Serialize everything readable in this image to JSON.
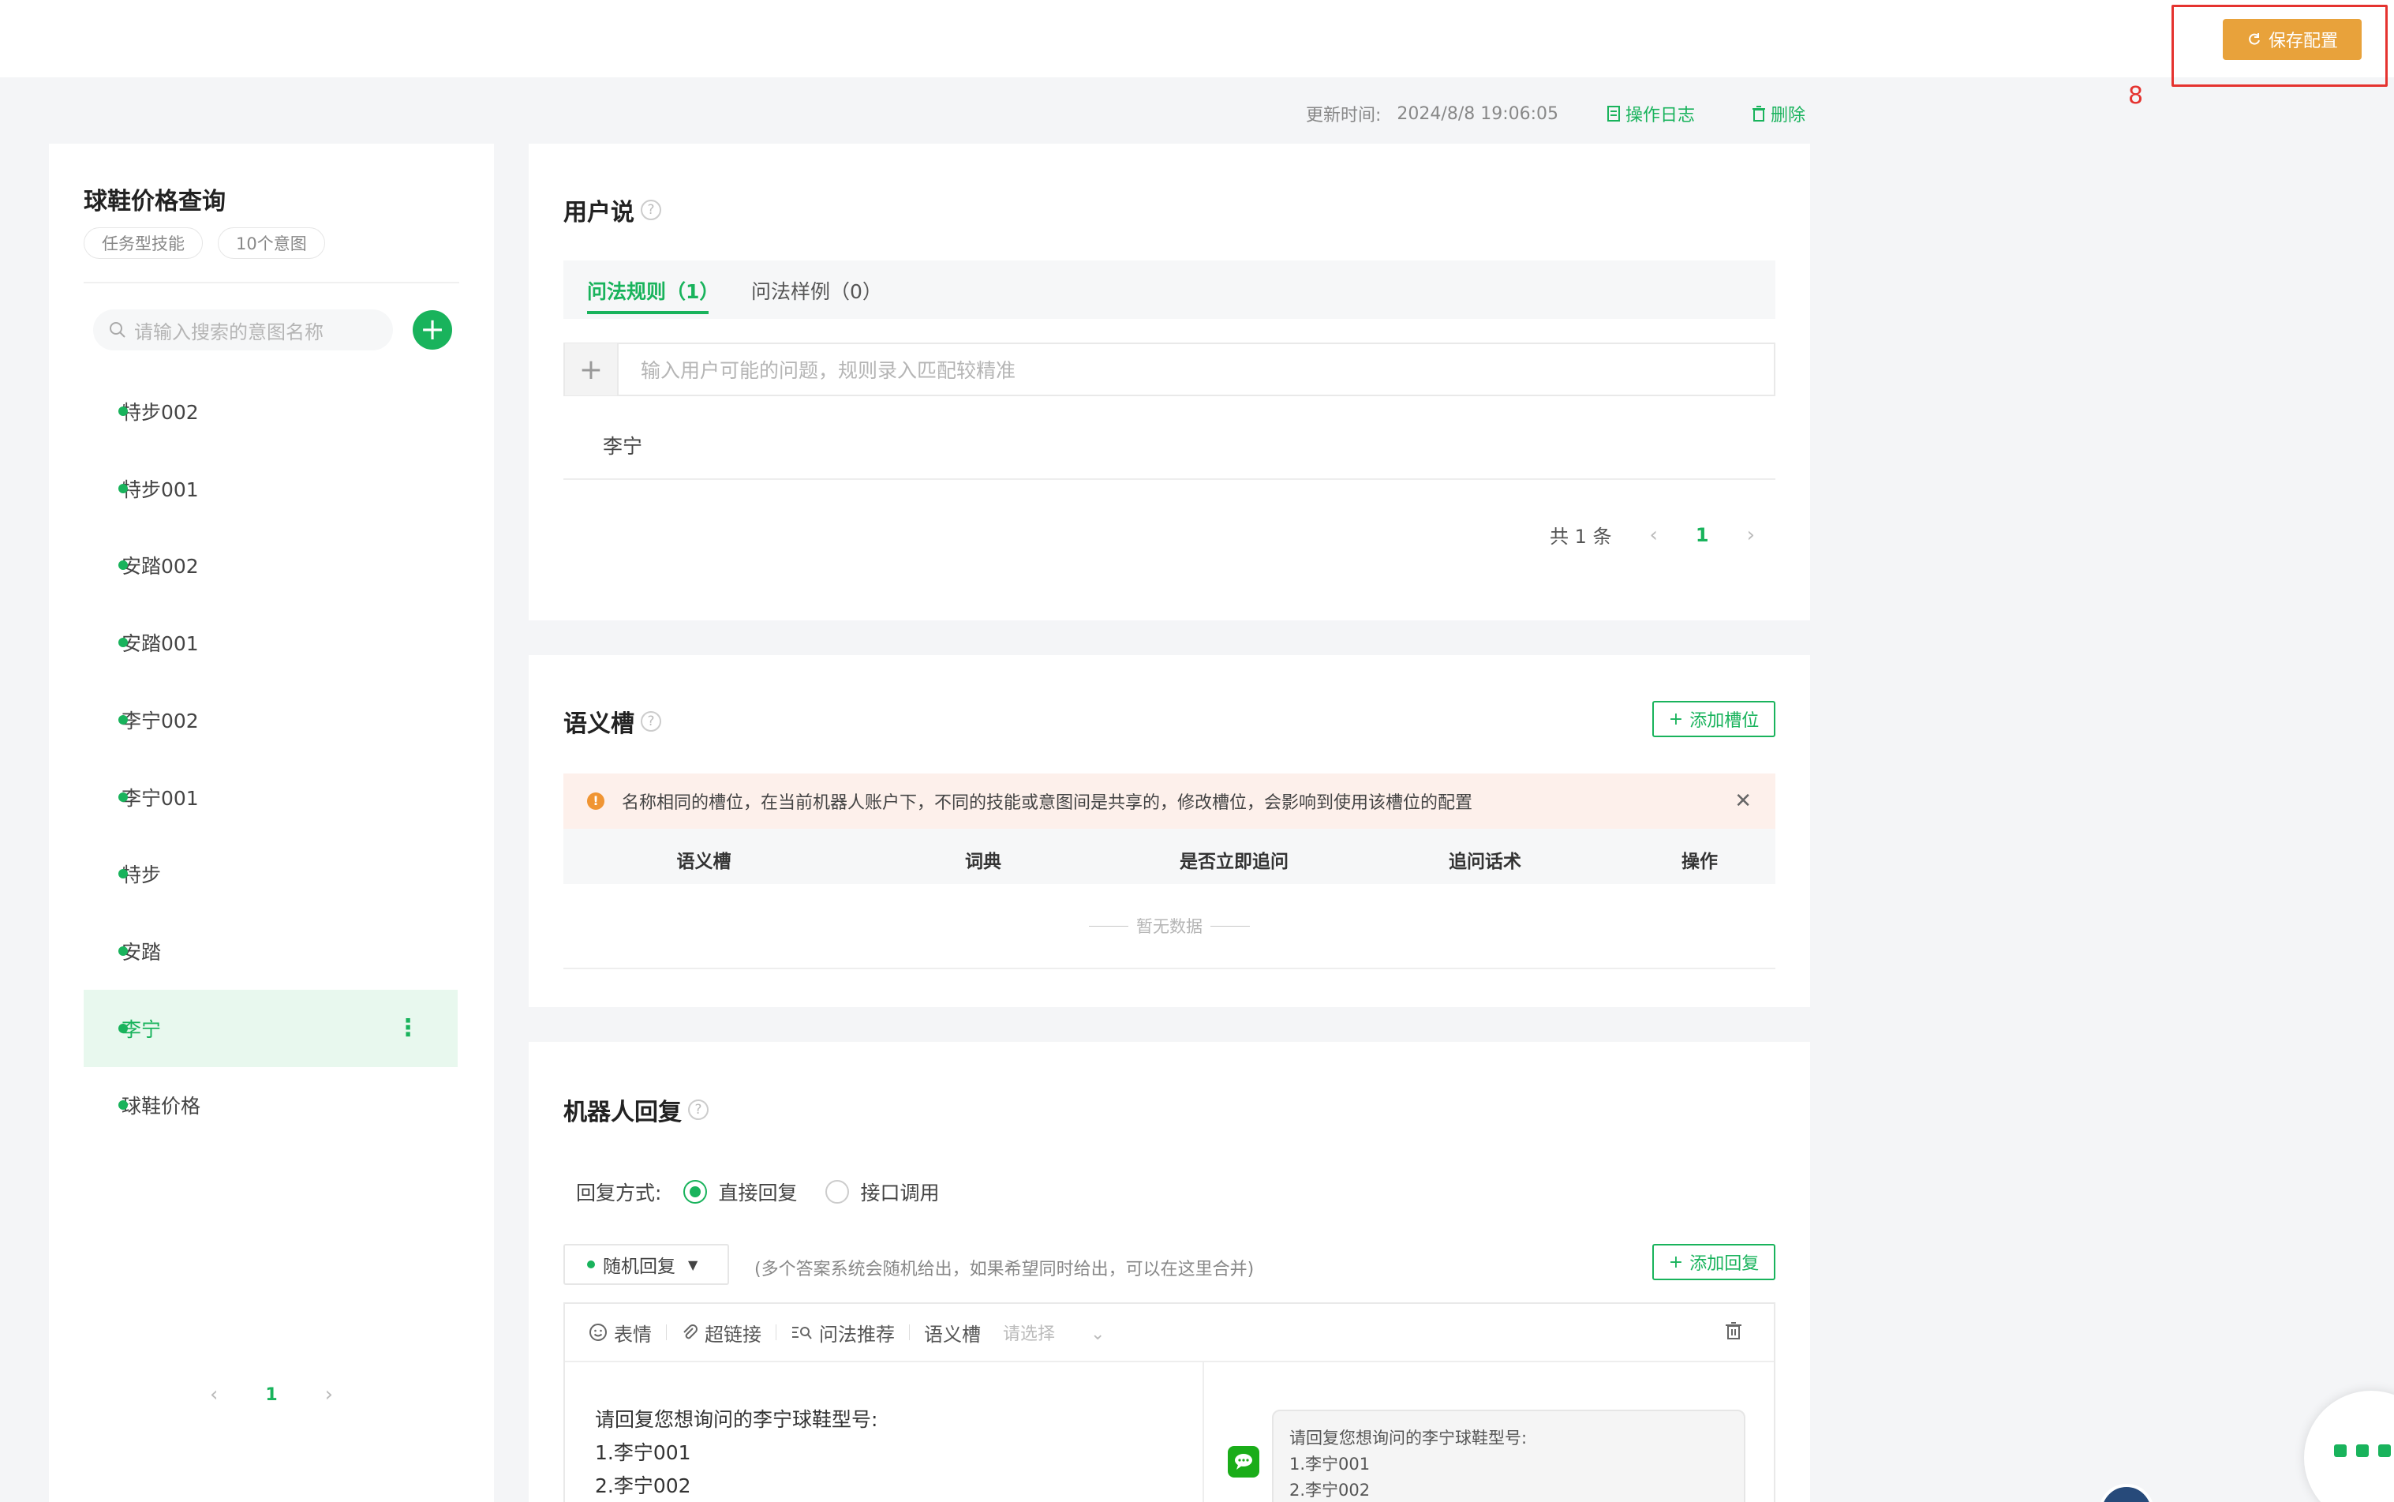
{
  "header": {
    "save_label": "保存配置",
    "annotation_number": "8",
    "updated_label": "更新时间:",
    "updated_time": "2024/8/8 19:06:05",
    "log_label": "操作日志",
    "delete_label": "删除"
  },
  "sidebar": {
    "skill_name": "球鞋价格查询",
    "tags": [
      "任务型技能",
      "10个意图"
    ],
    "search_placeholder": "请输入搜索的意图名称",
    "intents": [
      {
        "label": "特步002",
        "active": false
      },
      {
        "label": "特步001",
        "active": false
      },
      {
        "label": "安踏002",
        "active": false
      },
      {
        "label": "安踏001",
        "active": false
      },
      {
        "label": "李宁002",
        "active": false
      },
      {
        "label": "李宁001",
        "active": false
      },
      {
        "label": "特步",
        "active": false
      },
      {
        "label": "安踏",
        "active": false
      },
      {
        "label": "李宁",
        "active": true
      },
      {
        "label": "球鞋价格",
        "active": false
      }
    ],
    "page": "1"
  },
  "user_says": {
    "title": "用户说",
    "tabs": [
      "问法规则（1）",
      "问法样例（0）"
    ],
    "input_placeholder": "输入用户可能的问题，规则录入匹配较精准",
    "rules": [
      "李宁"
    ],
    "total": "共 1 条",
    "page": "1"
  },
  "slots": {
    "title": "语义槽",
    "add_label": "添加槽位",
    "alert": "名称相同的槽位，在当前机器人账户下，不同的技能或意图间是共享的，修改槽位，会影响到使用该槽位的配置",
    "columns": [
      "语义槽",
      "词典",
      "是否立即追问",
      "追问话术",
      "操作"
    ],
    "empty": "暂无数据"
  },
  "bot_reply": {
    "title": "机器人回复",
    "mode_label": "回复方式:",
    "modes": [
      "直接回复",
      "接口调用"
    ],
    "selected_mode": "直接回复",
    "random_label": "随机回复",
    "hint": "(多个答案系统会随机给出，如果希望同时给出，可以在这里合并)",
    "add_label": "添加回复",
    "toolbar": {
      "emoji": "表情",
      "link": "超链接",
      "recommend": "问法推荐",
      "slot": "语义槽",
      "slot_placeholder": "请选择"
    },
    "content_lines": [
      "请回复您想询问的李宁球鞋型号:",
      "1.李宁001",
      "2.李宁002"
    ],
    "preview_lines": [
      "请回复您想询问的李宁球鞋型号:",
      "1.李宁001",
      "2.李宁002"
    ]
  },
  "colors": {
    "accent": "#19b35c",
    "save_button": "#e8a23b",
    "highlight": "#e5332f"
  }
}
